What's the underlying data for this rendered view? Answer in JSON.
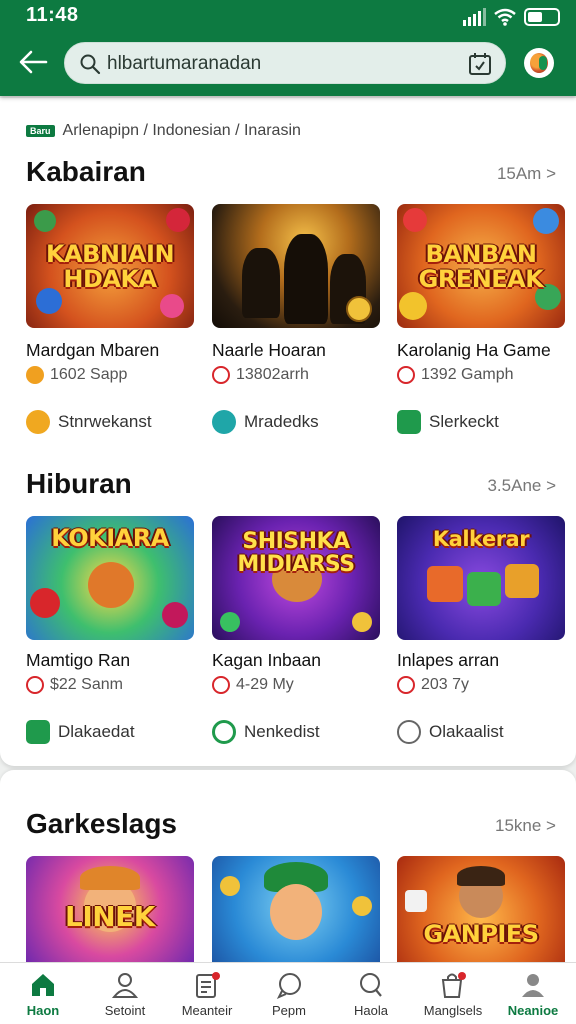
{
  "status": {
    "time": "11:48"
  },
  "search": {
    "value": "hlbartumaranadan"
  },
  "breadcrumb": {
    "tag": "Baru",
    "path": "Arlenapipn / Indonesian / Inarasin"
  },
  "sections": [
    {
      "title": "Kabairan",
      "more": "15Am >",
      "games": [
        {
          "art_text": "KABNIAIN HDAKA",
          "name": "Mardgan Mbaren",
          "meta": "1602 Sapp",
          "tag": "Stnrwekanst"
        },
        {
          "art_text": "",
          "name": "Naarle Hoaran",
          "meta": "13802arrh",
          "tag": "Mradedks"
        },
        {
          "art_text": "BANBAN GRENEAK",
          "name": "Karolanig Ha Game",
          "meta": "1392 Gamph",
          "tag": "Slerkeckt"
        }
      ]
    },
    {
      "title": "Hiburan",
      "more": "3.5Ane >",
      "games": [
        {
          "art_text": "KOKIARA",
          "name": "Mamtigo Ran",
          "meta": "$22 Sanm",
          "tag": "Dlakaedat"
        },
        {
          "art_text": "SHISHKA MIDIARSS",
          "name": "Kagan Inbaan",
          "meta": "4-29 My",
          "tag": "Nenkedist"
        },
        {
          "art_text": "Kalkerar",
          "name": "Inlapes arran",
          "meta": "203 7y",
          "tag": "Olakaalist"
        }
      ]
    },
    {
      "title": "Garkeslags",
      "more": "15kne >",
      "games": [
        {
          "art_text": "LINEK"
        },
        {
          "art_text": ""
        },
        {
          "art_text": "GANPIES"
        }
      ]
    }
  ],
  "nav": [
    {
      "label": "Haon",
      "icon": "home-icon"
    },
    {
      "label": "Setoint",
      "icon": "person-icon"
    },
    {
      "label": "Meanteir",
      "icon": "clipboard-icon"
    },
    {
      "label": "Pepm",
      "icon": "chat-icon"
    },
    {
      "label": "Haola",
      "icon": "search-icon"
    },
    {
      "label": "Manglsels",
      "icon": "bag-icon"
    },
    {
      "label": "Neanioe",
      "icon": "profile-icon"
    }
  ],
  "colors": {
    "brand": "#0d7a41",
    "nav_active": "#0d7a41",
    "meta_red": "#d8262b"
  }
}
